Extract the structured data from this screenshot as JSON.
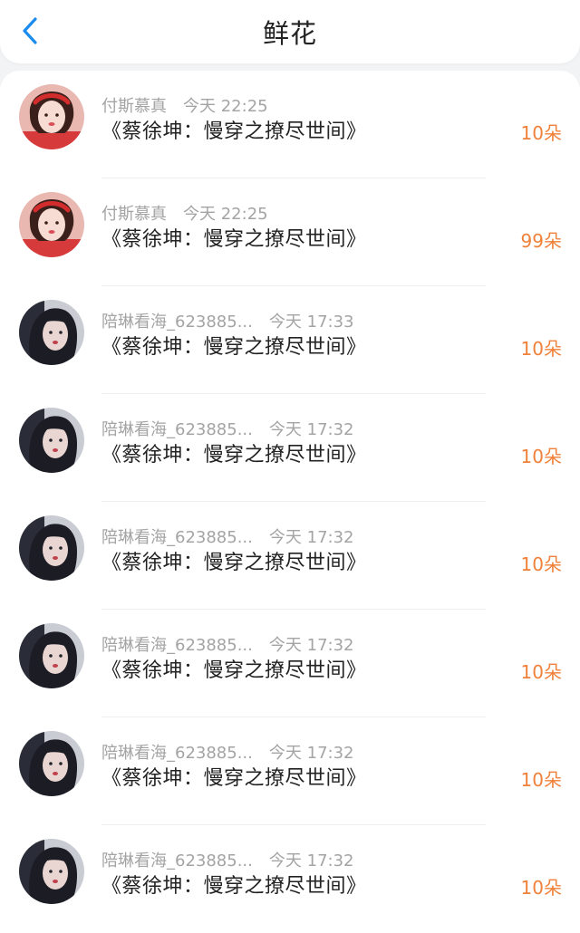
{
  "header": {
    "title": "鲜花"
  },
  "gifts": [
    {
      "name": "付斯慕真",
      "time": "今天 22:25",
      "book": "《蔡徐坤：慢穿之撩尽世间》",
      "count": "10朵",
      "avatar": "girl-red-headband"
    },
    {
      "name": "付斯慕真",
      "time": "今天 22:25",
      "book": "《蔡徐坤：慢穿之撩尽世间》",
      "count": "99朵",
      "avatar": "girl-red-headband"
    },
    {
      "name": "陪琳看海_623885...",
      "time": "今天 17:33",
      "book": "《蔡徐坤：慢穿之撩尽世间》",
      "count": "10朵",
      "avatar": "girl-dark-hair"
    },
    {
      "name": "陪琳看海_623885...",
      "time": "今天 17:32",
      "book": "《蔡徐坤：慢穿之撩尽世间》",
      "count": "10朵",
      "avatar": "girl-dark-hair"
    },
    {
      "name": "陪琳看海_623885...",
      "time": "今天 17:32",
      "book": "《蔡徐坤：慢穿之撩尽世间》",
      "count": "10朵",
      "avatar": "girl-dark-hair"
    },
    {
      "name": "陪琳看海_623885...",
      "time": "今天 17:32",
      "book": "《蔡徐坤：慢穿之撩尽世间》",
      "count": "10朵",
      "avatar": "girl-dark-hair"
    },
    {
      "name": "陪琳看海_623885...",
      "time": "今天 17:32",
      "book": "《蔡徐坤：慢穿之撩尽世间》",
      "count": "10朵",
      "avatar": "girl-dark-hair"
    },
    {
      "name": "陪琳看海_623885...",
      "time": "今天 17:32",
      "book": "《蔡徐坤：慢穿之撩尽世间》",
      "count": "10朵",
      "avatar": "girl-dark-hair"
    }
  ],
  "colors": {
    "accent": "#1a8cf0",
    "count": "#f0813a"
  }
}
